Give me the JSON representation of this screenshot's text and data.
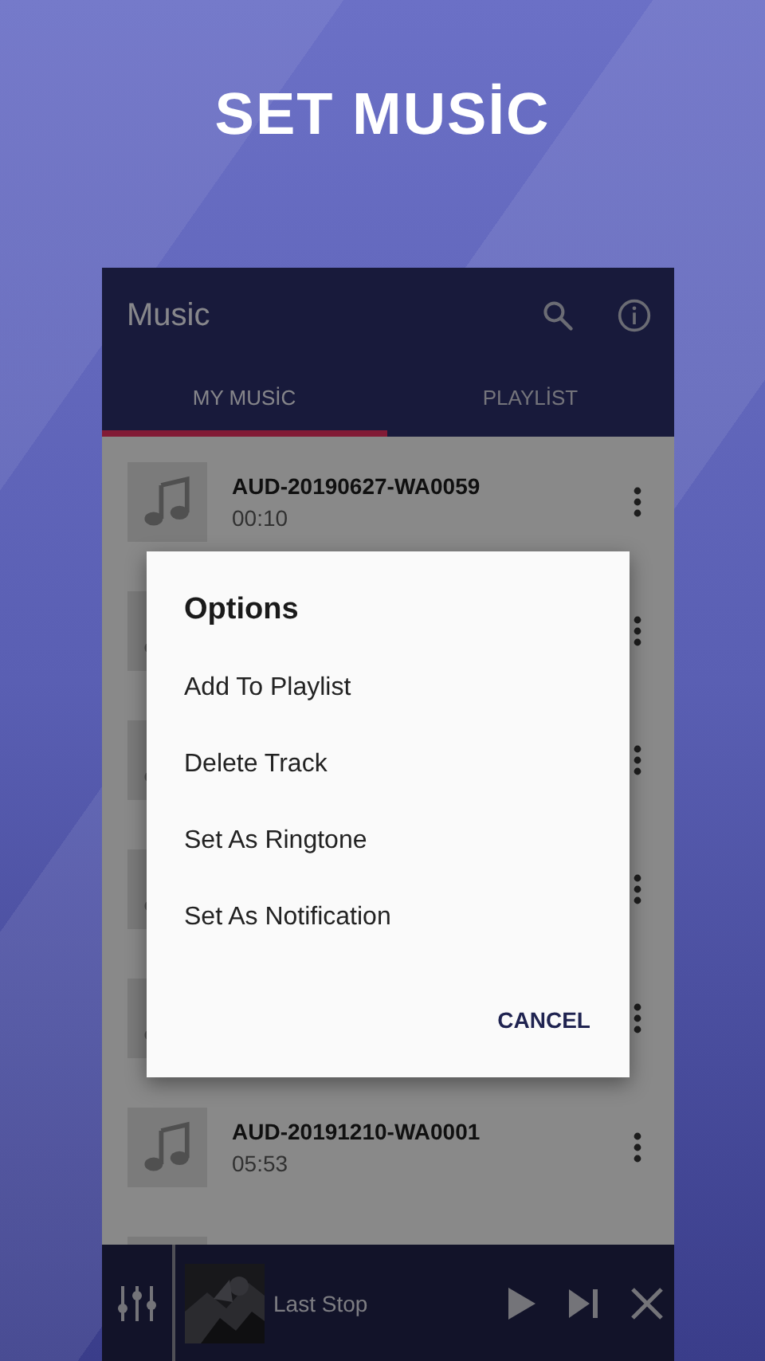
{
  "headline": "SET MUSİC",
  "app_bar": {
    "title": "Music"
  },
  "tabs": [
    {
      "label": "MY MUSİC",
      "selected": true
    },
    {
      "label": "PLAYLİST",
      "selected": false
    }
  ],
  "tracks": [
    {
      "kind": "track",
      "title": "AUD-20190627-WA0059",
      "duration": "00:10"
    },
    {
      "kind": "covered"
    },
    {
      "kind": "covered"
    },
    {
      "kind": "covered"
    },
    {
      "kind": "covered"
    },
    {
      "kind": "track",
      "title": "AUD-20191210-WA0001",
      "duration": "05:53"
    },
    {
      "kind": "cut"
    }
  ],
  "dialog": {
    "title": "Options",
    "options": [
      "Add To Playlist",
      "Delete Track",
      "Set As Ringtone",
      "Set As Notification"
    ],
    "button": "CANCEL"
  },
  "player": {
    "title": "Last Stop"
  }
}
